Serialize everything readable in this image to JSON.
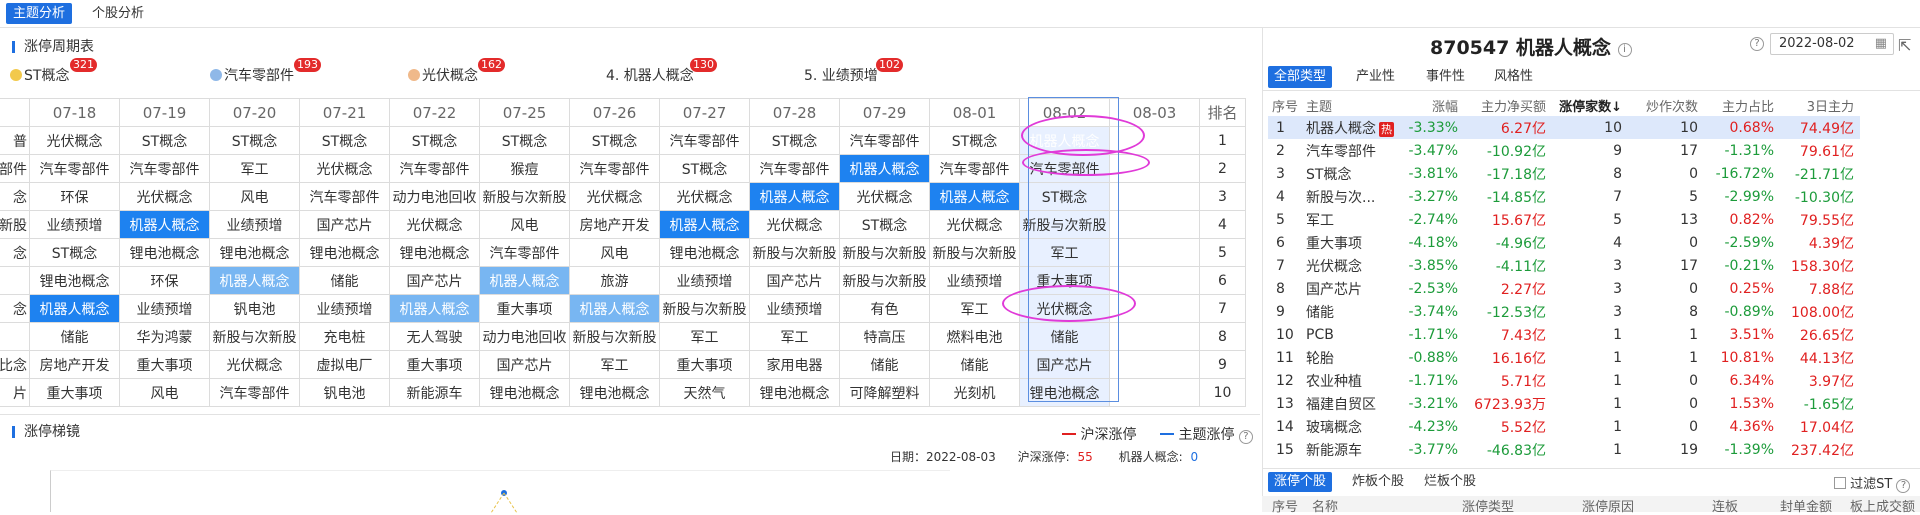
{
  "topbar": {
    "tab_active": "主题分析",
    "tab_other": "个股分析"
  },
  "cycle": {
    "title": "涨停周期表",
    "legend": [
      {
        "label": "ST概念",
        "count": "321",
        "color": "#f2c94c"
      },
      {
        "label": "汽车零部件",
        "count": "193",
        "color": "#8fb8e8"
      },
      {
        "label": "光伏概念",
        "count": "162",
        "color": "#f0b98a"
      },
      {
        "label": "4. 机器人概念",
        "count": "130",
        "color": ""
      },
      {
        "label": "5. 业绩预增",
        "count": "102",
        "color": ""
      }
    ],
    "dates": [
      "",
      "07-18",
      "07-19",
      "07-20",
      "07-21",
      "07-22",
      "07-25",
      "07-26",
      "07-27",
      "07-28",
      "07-29",
      "08-01",
      "08-02",
      "08-03",
      "排名"
    ],
    "rows": [
      [
        "普",
        "光伏概念",
        "ST概念",
        "ST概念",
        "ST概念",
        "ST概念",
        "ST概念",
        "ST概念",
        "汽车零部件",
        "ST概念",
        "汽车零部件",
        "ST概念",
        "机器人概念",
        "",
        "1"
      ],
      [
        "部件",
        "汽车零部件",
        "汽车零部件",
        "军工",
        "光伏概念",
        "汽车零部件",
        "猴痘",
        "汽车零部件",
        "ST概念",
        "汽车零部件",
        "机器人概念",
        "汽车零部件",
        "汽车零部件",
        "",
        "2"
      ],
      [
        "念",
        "环保",
        "光伏概念",
        "风电",
        "汽车零部件",
        "动力电池回收",
        "新股与次新股",
        "光伏概念",
        "光伏概念",
        "机器人概念",
        "光伏概念",
        "机器人概念",
        "ST概念",
        "",
        "3"
      ],
      [
        "新股",
        "业绩预增",
        "机器人概念",
        "业绩预增",
        "国产芯片",
        "光伏概念",
        "风电",
        "房地产开发",
        "机器人概念",
        "光伏概念",
        "ST概念",
        "光伏概念",
        "新股与次新股",
        "",
        "4"
      ],
      [
        "念",
        "ST概念",
        "锂电池概念",
        "锂电池概念",
        "锂电池概念",
        "锂电池概念",
        "汽车零部件",
        "风电",
        "锂电池概念",
        "新股与次新股",
        "新股与次新股",
        "新股与次新股",
        "军工",
        "",
        "5"
      ],
      [
        "",
        "锂电池概念",
        "环保",
        "机器人概念",
        "储能",
        "国产芯片",
        "机器人概念",
        "旅游",
        "业绩预增",
        "国产芯片",
        "新股与次新股",
        "业绩预增",
        "重大事项",
        "",
        "6"
      ],
      [
        "念",
        "机器人概念",
        "业绩预增",
        "钒电池",
        "业绩预增",
        "机器人概念",
        "重大事项",
        "机器人概念",
        "新股与次新股",
        "业绩预增",
        "有色",
        "军工",
        "光伏概念",
        "",
        "7"
      ],
      [
        "",
        "储能",
        "华为鸿蒙",
        "新股与次新股",
        "充电桩",
        "无人驾驶",
        "动力电池回收",
        "新股与次新股",
        "军工",
        "军工",
        "特高压",
        "燃料电池",
        "储能",
        "",
        "8"
      ],
      [
        "比念",
        "房地产开发",
        "重大事项",
        "光伏概念",
        "虚拟电厂",
        "重大事项",
        "国产芯片",
        "军工",
        "重大事项",
        "家用电器",
        "储能",
        "储能",
        "国产芯片",
        "",
        "9"
      ],
      [
        "片",
        "重大事项",
        "风电",
        "汽车零部件",
        "钒电池",
        "新能源车",
        "锂电池概念",
        "锂电池概念",
        "天然气",
        "锂电池概念",
        "可降解塑料",
        "光刻机",
        "锂电池概念",
        "",
        "10"
      ]
    ]
  },
  "ladder": {
    "title": "涨停梯镜",
    "legend_hs": "沪深涨停",
    "legend_theme": "主题涨停",
    "hs_color": "#e02020",
    "theme_color": "#1e6fe0",
    "date_text": "日期：2022-08-03",
    "hs_label": "沪深涨停:",
    "hs_value": "55",
    "theme_label": "机器人概念:",
    "theme_value": "0"
  },
  "right": {
    "code_title": "870547 机器人概念",
    "date_value": "2022-08-02",
    "tabs": [
      "全部类型",
      "产业性",
      "事件性",
      "风格性"
    ],
    "headers": [
      "序号",
      "主题",
      "涨幅",
      "主力净买额",
      "涨停家数↓",
      "炒作次数",
      "主力占比",
      "3日主力"
    ],
    "hot_label": "热",
    "rows": [
      [
        "1",
        "机器人概念",
        "-3.33%",
        "6.27亿",
        "10",
        "10",
        "0.68%",
        "74.49亿"
      ],
      [
        "2",
        "汽车零部件",
        "-3.47%",
        "-10.92亿",
        "9",
        "17",
        "-1.31%",
        "79.61亿"
      ],
      [
        "3",
        "ST概念",
        "-3.81%",
        "-17.18亿",
        "8",
        "0",
        "-16.72%",
        "-21.71亿"
      ],
      [
        "4",
        "新股与次...",
        "-3.27%",
        "-14.85亿",
        "7",
        "5",
        "-2.99%",
        "-10.30亿"
      ],
      [
        "5",
        "军工",
        "-2.74%",
        "15.67亿",
        "5",
        "13",
        "0.82%",
        "79.55亿"
      ],
      [
        "6",
        "重大事项",
        "-4.18%",
        "-4.96亿",
        "4",
        "0",
        "-2.59%",
        "4.39亿"
      ],
      [
        "7",
        "光伏概念",
        "-3.85%",
        "-4.11亿",
        "3",
        "17",
        "-0.21%",
        "158.30亿"
      ],
      [
        "8",
        "国产芯片",
        "-2.53%",
        "2.27亿",
        "3",
        "0",
        "0.25%",
        "7.88亿"
      ],
      [
        "9",
        "储能",
        "-3.74%",
        "-12.53亿",
        "3",
        "8",
        "-0.89%",
        "108.00亿"
      ],
      [
        "10",
        "PCB",
        "-1.71%",
        "7.43亿",
        "1",
        "1",
        "3.51%",
        "26.65亿"
      ],
      [
        "11",
        "轮胎",
        "-0.88%",
        "16.16亿",
        "1",
        "1",
        "10.81%",
        "44.13亿"
      ],
      [
        "12",
        "农业种植",
        "-1.71%",
        "5.71亿",
        "1",
        "0",
        "6.34%",
        "3.97亿"
      ],
      [
        "13",
        "福建自贸区",
        "-3.21%",
        "6723.93万",
        "1",
        "0",
        "1.53%",
        "-1.65亿"
      ],
      [
        "14",
        "玻璃概念",
        "-4.23%",
        "5.52亿",
        "1",
        "0",
        "4.36%",
        "17.04亿"
      ],
      [
        "15",
        "新能源车",
        "-3.77%",
        "-46.83亿",
        "1",
        "19",
        "-1.39%",
        "237.42亿"
      ]
    ],
    "bottom_tabs": [
      "涨停个股",
      "炸板个股",
      "烂板个股"
    ],
    "filter_st": "过滤ST",
    "sub_headers": [
      "序号",
      "名称",
      "涨停类型",
      "涨停原因",
      "连板",
      "封单金额",
      "板上成交额"
    ]
  }
}
